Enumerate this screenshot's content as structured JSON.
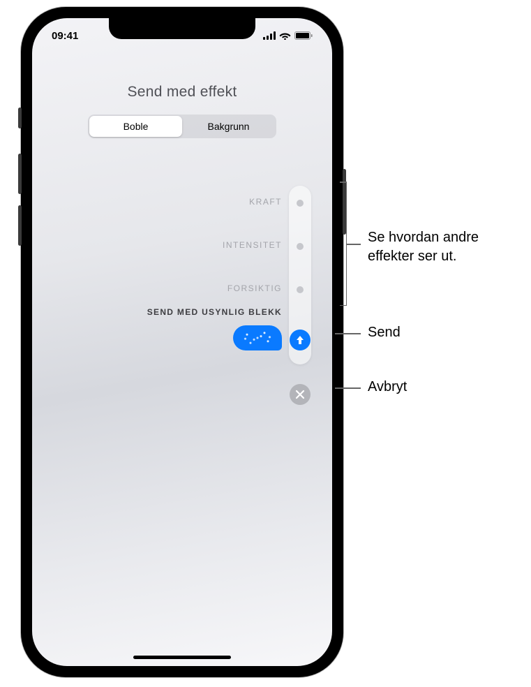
{
  "status": {
    "time": "09:41"
  },
  "title": "Send med effekt",
  "segments": {
    "boble": "Boble",
    "bakgrunn": "Bakgrunn"
  },
  "effects": {
    "kraft": "KRAFT",
    "intensitet": "INTENSITET",
    "forsiktig": "FORSIKTIG",
    "selected": "SEND MED USYNLIG BLEKK"
  },
  "callouts": {
    "preview": "Se hvordan andre effekter ser ut.",
    "send": "Send",
    "cancel": "Avbryt"
  }
}
